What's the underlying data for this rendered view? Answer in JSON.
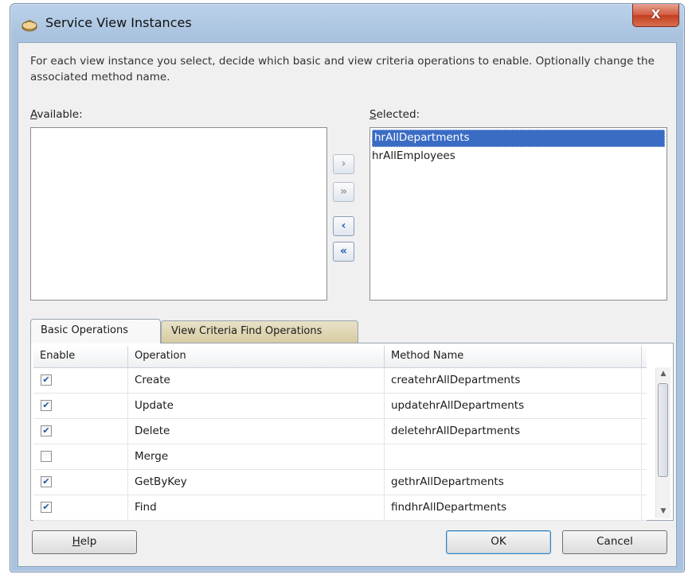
{
  "window": {
    "title": "Service View Instances",
    "close_glyph": "X",
    "app_icon": "dialog-app-icon"
  },
  "description": "For each view instance you select, decide which basic and view criteria operations to enable. Optionally change the associated method name.",
  "available": {
    "label_mnemonic": "A",
    "label_rest": "vailable:",
    "items": []
  },
  "selected": {
    "label_mnemonic": "S",
    "label_rest": "elected:",
    "items": [
      {
        "label": "hrAllDepartments",
        "selected": true
      },
      {
        "label": "hrAllEmployees",
        "selected": false
      }
    ]
  },
  "shuttle": {
    "move_right": "›",
    "move_all_right": "»",
    "move_left": "‹",
    "move_all_left": "«"
  },
  "tabs": [
    {
      "label": "Basic Operations",
      "active": true
    },
    {
      "label": "View Criteria Find Operations",
      "active": false
    }
  ],
  "table": {
    "columns": [
      "Enable",
      "Operation",
      "Method Name"
    ],
    "rows": [
      {
        "enabled": true,
        "operation": "Create",
        "method": "createhrAllDepartments"
      },
      {
        "enabled": true,
        "operation": "Update",
        "method": "updatehrAllDepartments"
      },
      {
        "enabled": true,
        "operation": "Delete",
        "method": "deletehrAllDepartments"
      },
      {
        "enabled": false,
        "operation": "Merge",
        "method": ""
      },
      {
        "enabled": true,
        "operation": "GetByKey",
        "method": "gethrAllDepartments"
      },
      {
        "enabled": true,
        "operation": "Find",
        "method": "findhrAllDepartments"
      }
    ]
  },
  "buttons": {
    "help_mnemonic": "H",
    "help_rest": "elp",
    "ok": "OK",
    "cancel": "Cancel"
  },
  "colors": {
    "selection": "#3a6cc4",
    "title_bar": "#bcd2ea",
    "close_button": "#d45a3f"
  }
}
